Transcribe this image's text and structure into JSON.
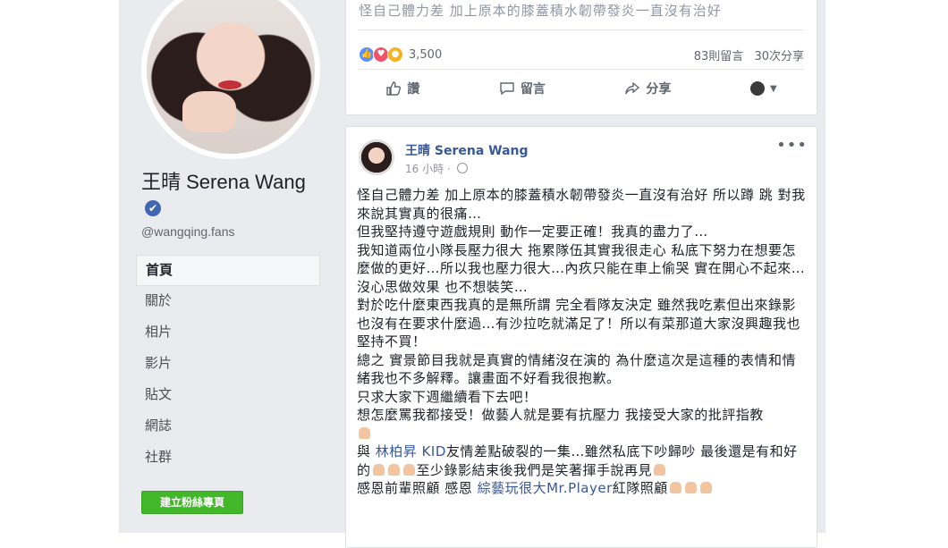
{
  "profile": {
    "name": "王晴 Serena Wang",
    "handle": "@wangqing.fans"
  },
  "nav": {
    "items": [
      "首頁",
      "關於",
      "相片",
      "影片",
      "貼文",
      "網誌",
      "社群"
    ],
    "active_index": 0
  },
  "create_page_button": "建立粉絲專頁",
  "card1": {
    "truncated_line": "怪自己體力差 加上原本的膝蓋積水韌帶發炎一直沒有治好",
    "reaction_count": "3,500",
    "comments": "83則留言",
    "shares": "30次分享",
    "actions": {
      "like": "讚",
      "comment": "留言",
      "share": "分享"
    }
  },
  "post": {
    "author": "王晴 Serena Wang",
    "time": "16 小時",
    "lines": [
      "怪自己體力差 加上原本的膝蓋積水韌帶發炎一直沒有治好 所以蹲 跳 對我來說其實真的很痛…",
      "但我堅持遵守遊戲規則 動作一定要正確！我真的盡力了…",
      "我知道兩位小隊長壓力很大 拖累隊伍其實我很走心 私底下努力在想要怎麼做的更好…所以我也壓力很大…內疚只能在車上偷哭 實在開心不起來…沒心思做效果 也不想裝笑…",
      "對於吃什麼東西我真的是無所謂 完全看隊友決定 雖然我吃素但出來錄影也沒有在要求什麼過…有沙拉吃就滿足了！所以有菜那道大家沒興趣我也堅持不買！",
      "總之 實景節目我就是真實的情緒沒在演的 為什麼這次是這種的表情和情緒我也不多解釋。讓畫面不好看我很抱歉。",
      "只求大家下週繼續看下去吧！",
      "想怎麼罵我都接受！做藝人就是要有抗壓力 我接受大家的批評指教"
    ],
    "mention_prefix": "與",
    "mention_name": "林柏昇 KID",
    "mention_rest": "友情差點破裂的一集…雖然私底下吵歸吵 最後還是有和好的",
    "mention_tail": "至少錄影結束後我們是笑著揮手說再見",
    "thanks_prefix": "感恩前輩照顧 感恩",
    "thanks_mention": "綜藝玩很大Mr.Player",
    "thanks_rest": "紅隊照顧"
  }
}
